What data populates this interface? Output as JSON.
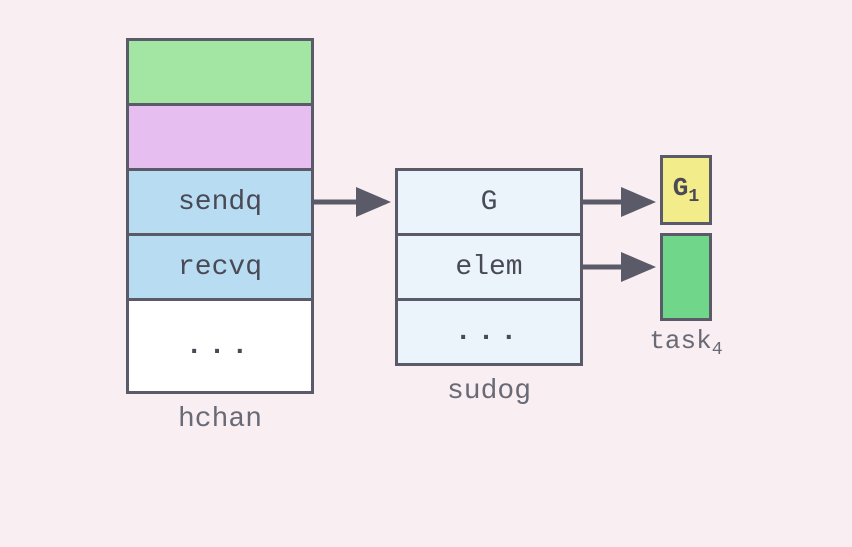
{
  "hchan": {
    "label": "hchan",
    "cells": {
      "sendq": "sendq",
      "recvq": "recvq",
      "dots": "..."
    }
  },
  "sudog": {
    "label": "sudog",
    "cells": {
      "g": "G",
      "elem": "elem",
      "dots": "..."
    }
  },
  "target_g": {
    "label_main": "G",
    "label_sub": "1"
  },
  "task": {
    "label_main": "task",
    "label_sub": "4"
  },
  "colors": {
    "border": "#5a5a68",
    "green": "#a3e5a3",
    "purple": "#e6bff0",
    "blue": "#b8ddf2",
    "paleblue": "#ecf4fb",
    "yellow": "#f2ec8a",
    "green2": "#6fd68a",
    "white": "#ffffff"
  }
}
